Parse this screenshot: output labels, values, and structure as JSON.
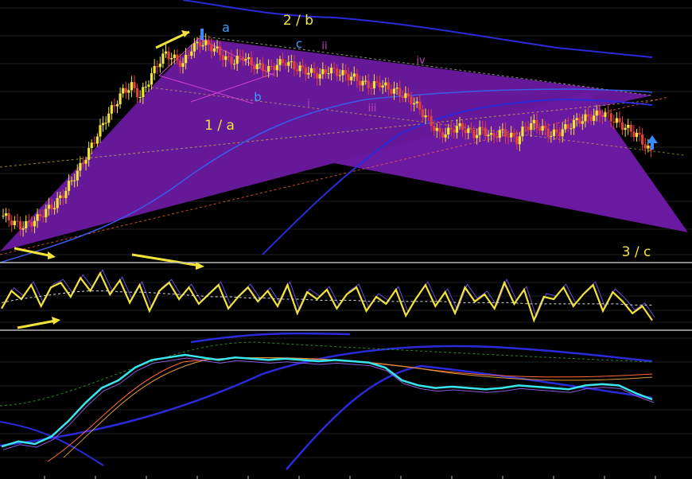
{
  "chart_data": {
    "type": "line",
    "panels": [
      {
        "name": "price",
        "kind": "candlestick"
      },
      {
        "name": "oscillator"
      },
      {
        "name": "indicator"
      }
    ],
    "wave_labels": [
      {
        "text": "a",
        "color": "#3aa0ff"
      },
      {
        "text": "2 / b",
        "color": "#f2e33a"
      },
      {
        "text": "c",
        "color": "#3aa0ff"
      },
      {
        "text": "ii",
        "color": "#c040c0"
      },
      {
        "text": "iv",
        "color": "#c040c0"
      },
      {
        "text": "b",
        "color": "#3aa0ff"
      },
      {
        "text": "i",
        "color": "#c040c0"
      },
      {
        "text": "iii",
        "color": "#c040c0"
      },
      {
        "text": "1 / a",
        "color": "#f2e33a"
      },
      {
        "text": "3 / c",
        "color": "#f2e33a"
      }
    ],
    "price_close": [
      22,
      20,
      18,
      19,
      21,
      24,
      26,
      30,
      35,
      40,
      46,
      52,
      58,
      63,
      68,
      70,
      66,
      72,
      78,
      82,
      80,
      78,
      84,
      86,
      85,
      83,
      80,
      79,
      81,
      78,
      77,
      76,
      78,
      79,
      77,
      76,
      75,
      74,
      76,
      75,
      74,
      73,
      71,
      70,
      71,
      69,
      68,
      66,
      64,
      60,
      56,
      52,
      53,
      55,
      54,
      52,
      54,
      51,
      53,
      52,
      50,
      55,
      56,
      54,
      52,
      53,
      55,
      57,
      58,
      59,
      60,
      58,
      56,
      54,
      52,
      48,
      44
    ],
    "oscillator": [
      40,
      55,
      48,
      60,
      42,
      58,
      62,
      50,
      66,
      55,
      70,
      52,
      64,
      45,
      60,
      38,
      55,
      62,
      48,
      58,
      44,
      52,
      60,
      40,
      50,
      58,
      46,
      55,
      42,
      60,
      36,
      54,
      48,
      56,
      40,
      52,
      58,
      38,
      50,
      44,
      56,
      34,
      48,
      60,
      42,
      54,
      36,
      58,
      46,
      52,
      40,
      62,
      44,
      56,
      30,
      50,
      48,
      58,
      42,
      52,
      60,
      38,
      54,
      46,
      36,
      42,
      30
    ],
    "osc_signal": [
      45,
      48,
      50,
      52,
      54,
      55,
      55,
      54,
      54,
      53,
      52,
      51,
      50,
      50,
      49,
      49,
      48,
      48,
      47,
      47,
      47,
      46,
      46,
      46,
      46,
      46,
      45,
      45,
      45,
      45,
      44,
      44,
      44,
      44,
      44,
      44,
      43,
      43
    ],
    "indicator_main": [
      18,
      22,
      20,
      26,
      38,
      52,
      64,
      70,
      80,
      86,
      88,
      90,
      88,
      86,
      88,
      87,
      86,
      87,
      86,
      85,
      86,
      85,
      84,
      80,
      70,
      66,
      64,
      65,
      64,
      63,
      64,
      66,
      65,
      64,
      63,
      66,
      67,
      66,
      60,
      55
    ],
    "colors": {
      "bull": "#f2e33a",
      "bear": "#e04040",
      "pattern": "#6a1aa0",
      "grid": "#6a6a6a",
      "osc": "#f2e33a",
      "ind": "#38e6f0",
      "band": "#2a2ad8"
    }
  }
}
